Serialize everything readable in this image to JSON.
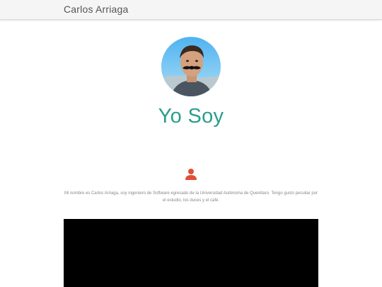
{
  "header": {
    "site_title": "Carlos Arriaga"
  },
  "profile": {
    "heading": "Yo Soy",
    "bio": "Mi nombre es Carlos Arriaga, soy ingeniero de Software egresado de la Universidad Autónoma de Querétaro. Tengo gusto peculiar por el estudio, los duces y el café.",
    "person_icon": "person-icon",
    "accent_color": "#2a9d8f",
    "icon_color": "#e04e3a"
  },
  "media": {
    "video_color": "#000000"
  }
}
